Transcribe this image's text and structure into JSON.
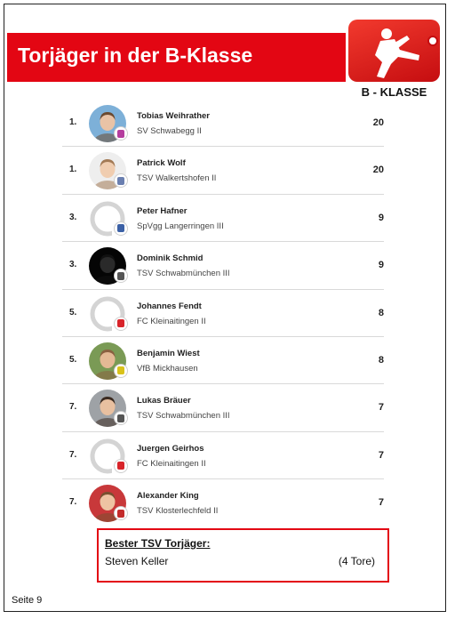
{
  "header": {
    "title": "Torjäger in der B-Klasse"
  },
  "logo": {
    "label": "B - KLASSE"
  },
  "scorers": [
    {
      "rank": "1.",
      "name": "Tobias Weihrather",
      "club": "SV Schwabegg II",
      "goals": "20",
      "avatar": "photo",
      "skin": "#e9c3a6",
      "hair": "#6b4a30",
      "bg": "#7db0d8",
      "club_color": "#b53d9e"
    },
    {
      "rank": "1.",
      "name": "Patrick Wolf",
      "club": "TSV Walkertshofen II",
      "goals": "20",
      "avatar": "photo",
      "skin": "#f0cdb0",
      "hair": "#a37a55",
      "bg": "#eeeeee",
      "club_color": "#6a7fb0"
    },
    {
      "rank": "3.",
      "name": "Peter Hafner",
      "club": "SpVgg Langerringen III",
      "goals": "9",
      "avatar": "placeholder",
      "club_color": "#3c61a6"
    },
    {
      "rank": "3.",
      "name": "Dominik Schmid",
      "club": "TSV Schwabmünchen III",
      "goals": "9",
      "avatar": "photo",
      "skin": "#2a2a2a",
      "hair": "#111111",
      "bg": "#050505",
      "club_color": "#555555"
    },
    {
      "rank": "5.",
      "name": "Johannes Fendt",
      "club": "FC Kleinaitingen II",
      "goals": "8",
      "avatar": "placeholder",
      "club_color": "#d8242a"
    },
    {
      "rank": "5.",
      "name": "Benjamin Wiest",
      "club": "VfB Mickhausen",
      "goals": "8",
      "avatar": "photo",
      "skin": "#e4b995",
      "hair": "#8a6040",
      "bg": "#7a9a55",
      "club_color": "#d9c21a"
    },
    {
      "rank": "7.",
      "name": "Lukas Bräuer",
      "club": "TSV Schwabmünchen III",
      "goals": "7",
      "avatar": "photo",
      "skin": "#e8c0a0",
      "hair": "#3a2a20",
      "bg": "#9ea2a6",
      "club_color": "#555555"
    },
    {
      "rank": "7.",
      "name": "Juergen Geirhos",
      "club": "FC Kleinaitingen II",
      "goals": "7",
      "avatar": "placeholder",
      "club_color": "#d8242a"
    },
    {
      "rank": "7.",
      "name": "Alexander King",
      "club": "TSV Klosterlechfeld II",
      "goals": "7",
      "avatar": "photo",
      "skin": "#eec3a3",
      "hair": "#7a5030",
      "bg": "#c8383a",
      "club_color": "#c32b2b"
    }
  ],
  "best_tsv": {
    "title": "Bester TSV Torjäger:",
    "name": "Steven Keller",
    "goals": "(4 Tore)"
  },
  "footer": {
    "page": "Seite 9"
  },
  "colors": {
    "accent_red": "#e30613",
    "divider": "#d9d9d9",
    "placeholder_gray": "#d4d4d4"
  },
  "icons": {
    "logo": "bundesliga-player-logo",
    "avatar_placeholder": "user-placeholder-icon"
  }
}
